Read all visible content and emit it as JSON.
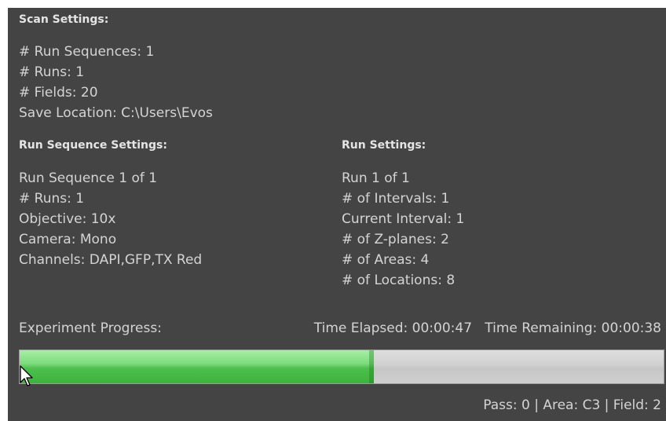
{
  "scan_settings": {
    "header": "Scan Settings:",
    "lines": [
      "# Run Sequences: 1",
      "# Runs: 1",
      "# Fields: 20",
      "Save Location: C:\\Users\\Evos"
    ]
  },
  "run_sequence_settings": {
    "header": "Run Sequence Settings:",
    "lines": [
      "Run Sequence 1 of 1",
      "# Runs: 1",
      "Objective: 10x",
      "Camera: Mono",
      "Channels: DAPI,GFP,TX Red"
    ]
  },
  "run_settings": {
    "header": "Run Settings:",
    "lines": [
      "Run 1 of 1",
      "# of Intervals: 1",
      "Current Interval:  1",
      "# of Z-planes: 2",
      "# of Areas: 4",
      "# of Locations: 8"
    ]
  },
  "progress": {
    "label": "Experiment Progress:",
    "time_elapsed": "Time Elapsed: 00:00:47",
    "time_remaining": "Time Remaining: 00:00:38",
    "fraction": 0.55,
    "fill_color": "#4cc04c"
  },
  "status_line": "Pass: 0 | Area: C3 | Field: 2",
  "colors": {
    "panel_background": "#444444",
    "text": "#d4d4d4"
  },
  "icons": {
    "cursor": "mouse-pointer-icon"
  }
}
